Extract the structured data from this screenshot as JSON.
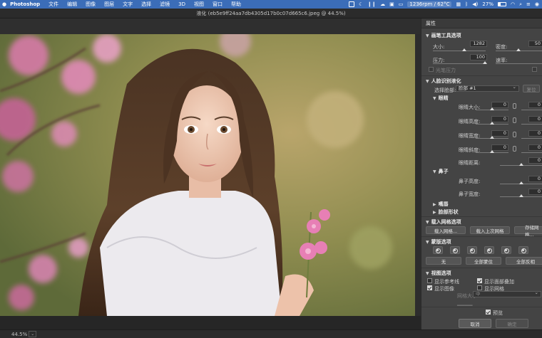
{
  "menubar": {
    "apple_icon": "apple-icon",
    "app_name": "Photoshop",
    "menus": [
      "文件",
      "编辑",
      "图像",
      "图层",
      "文字",
      "选择",
      "滤镜",
      "3D",
      "视图",
      "窗口",
      "帮助"
    ],
    "fan_stat": "1236rpm / 62°C",
    "battery": "27%"
  },
  "window": {
    "title": "液化 (eb5e9ff24aa7db4305d17b0c07d665c6.jpeg @ 44.5%)"
  },
  "status": {
    "zoom": "44.5%"
  },
  "panel": {
    "tab_label": "属性",
    "brush": {
      "header": "画笔工具选项",
      "size_label": "大小:",
      "size_value": "1282",
      "density_label": "密度:",
      "density_value": "50",
      "pressure_label": "压力:",
      "pressure_value": "100",
      "rate_label": "速率:",
      "stylus_label": "光笔压力"
    },
    "face": {
      "header": "人脸识别液化",
      "select_face_label": "选择脸部:",
      "select_face_value": "脸部 #1",
      "reset_label": "复位",
      "eyes_header": "眼睛",
      "eye_rows": [
        {
          "label": "眼睛大小:",
          "value": "0"
        },
        {
          "label": "眼睛高度:",
          "value": "0"
        },
        {
          "label": "眼睛宽度:",
          "value": "0"
        },
        {
          "label": "眼睛斜度:",
          "value": "0"
        },
        {
          "label": "眼睛距离:",
          "value": "0"
        }
      ],
      "nose_header": "鼻子",
      "nose_rows": [
        {
          "label": "鼻子高度:",
          "value": "0"
        },
        {
          "label": "鼻子宽度:",
          "value": "0"
        }
      ],
      "mouth_header": "嘴唇",
      "face_shape_header": "脸部形状"
    },
    "mesh": {
      "header": "载入网格选项",
      "load_mesh": "载入网格...",
      "load_last_mesh": "载入上次网格",
      "save_mesh": "存储网格..."
    },
    "mask": {
      "header": "蒙版选项",
      "none_label": "无",
      "mask_all": "全部蒙住",
      "invert_all": "全部反相"
    },
    "view": {
      "header": "视图选项",
      "show_guides": "显示参考线",
      "show_face_overlay": "显示面部叠加",
      "show_image": "显示图像",
      "show_mesh": "显示网格",
      "mesh_size_label": "网格大小:",
      "mesh_size_value": "中"
    },
    "preview_label": "预览",
    "cancel_label": "取消",
    "ok_label": "确定"
  },
  "colors": {
    "menubar": "#3b6db8",
    "panel_bg": "#444444",
    "canvas_bg": "#262626"
  }
}
